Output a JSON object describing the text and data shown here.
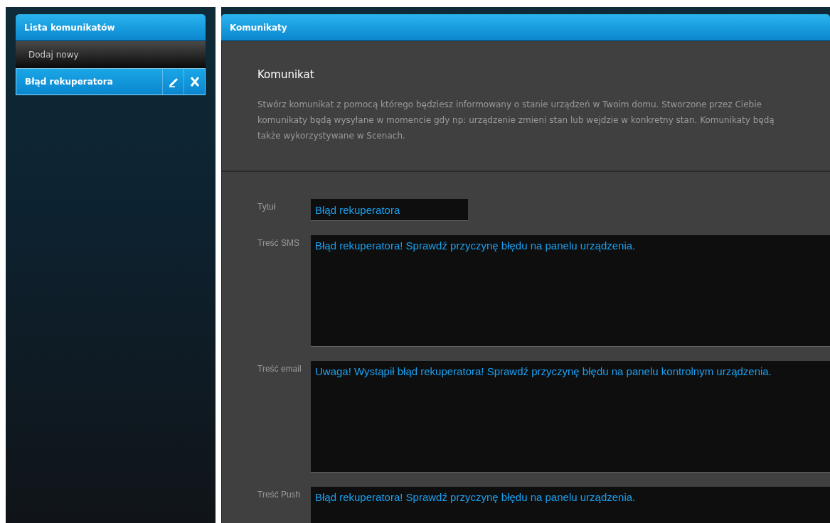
{
  "sidebar": {
    "title": "Lista komunikatów",
    "items": [
      {
        "label": "Dodaj nowy",
        "kind": "add",
        "selected": false
      },
      {
        "label": "Błąd rekuperatora",
        "kind": "message",
        "selected": true
      }
    ]
  },
  "main": {
    "title": "Komunikaty",
    "heading": "Komunikat",
    "description": "Stwórz komunikat z pomocą którego będziesz informowany o stanie urządzeń w Twoim domu. Stworzone przez Ciebie komunikaty będą wysyłane w momencie gdy np: urządzenie zmieni stan lub wejdzie w konkretny stan. Komunikaty będą także wykorzystywane w Scenach.",
    "fields": [
      {
        "label": "Tytuł",
        "kind": "input",
        "value": "Błąd rekuperatora"
      },
      {
        "label": "Treść SMS",
        "kind": "textarea",
        "value": "Błąd rekuperatora! Sprawdź przyczynę błędu na panelu urządzenia."
      },
      {
        "label": "Treść email",
        "kind": "textarea",
        "value": "Uwaga! Wystąpił błąd rekuperatora! Sprawdź przyczynę błędu na panelu kontrolnym urządzenia."
      },
      {
        "label": "Treść Push",
        "kind": "textarea",
        "value": "Błąd rekuperatora! Sprawdź przyczynę błędu na panelu urządzenia."
      }
    ]
  }
}
